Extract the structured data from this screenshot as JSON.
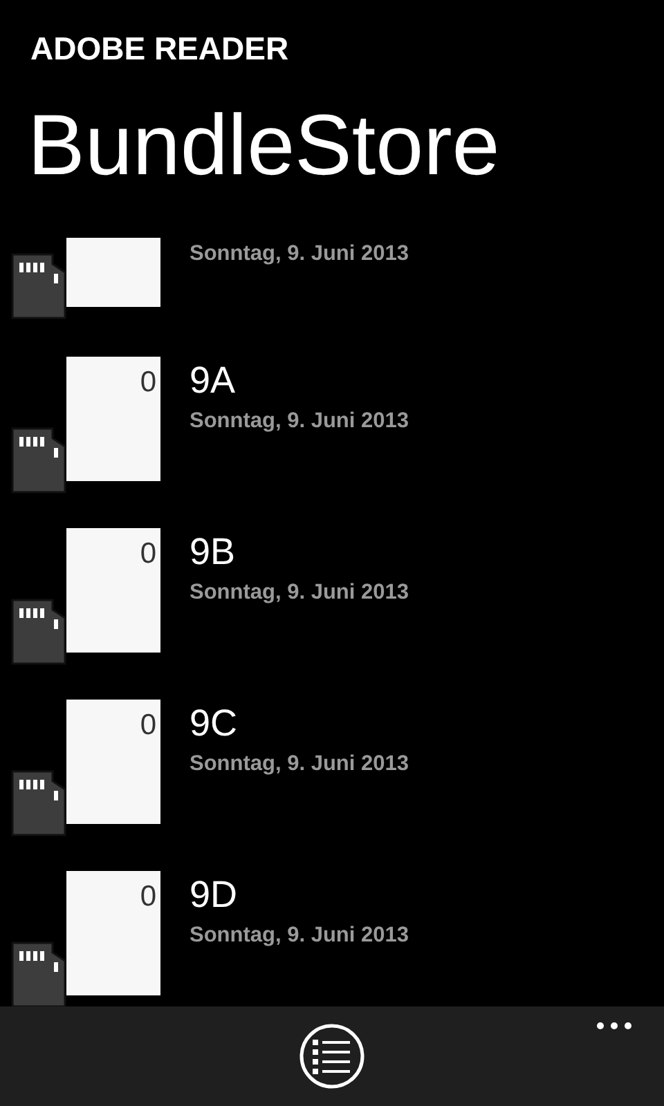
{
  "app_title": "ADOBE READER",
  "page_title": "BundleStore",
  "files": [
    {
      "date": "Sonntag, 9. Juni 2013"
    },
    {
      "title": "9A",
      "count": "0",
      "date": "Sonntag, 9. Juni 2013"
    },
    {
      "title": "9B",
      "count": "0",
      "date": "Sonntag, 9. Juni 2013"
    },
    {
      "title": "9C",
      "count": "0",
      "date": "Sonntag, 9. Juni 2013"
    },
    {
      "title": "9D",
      "count": "0",
      "date": "Sonntag, 9. Juni 2013"
    }
  ]
}
